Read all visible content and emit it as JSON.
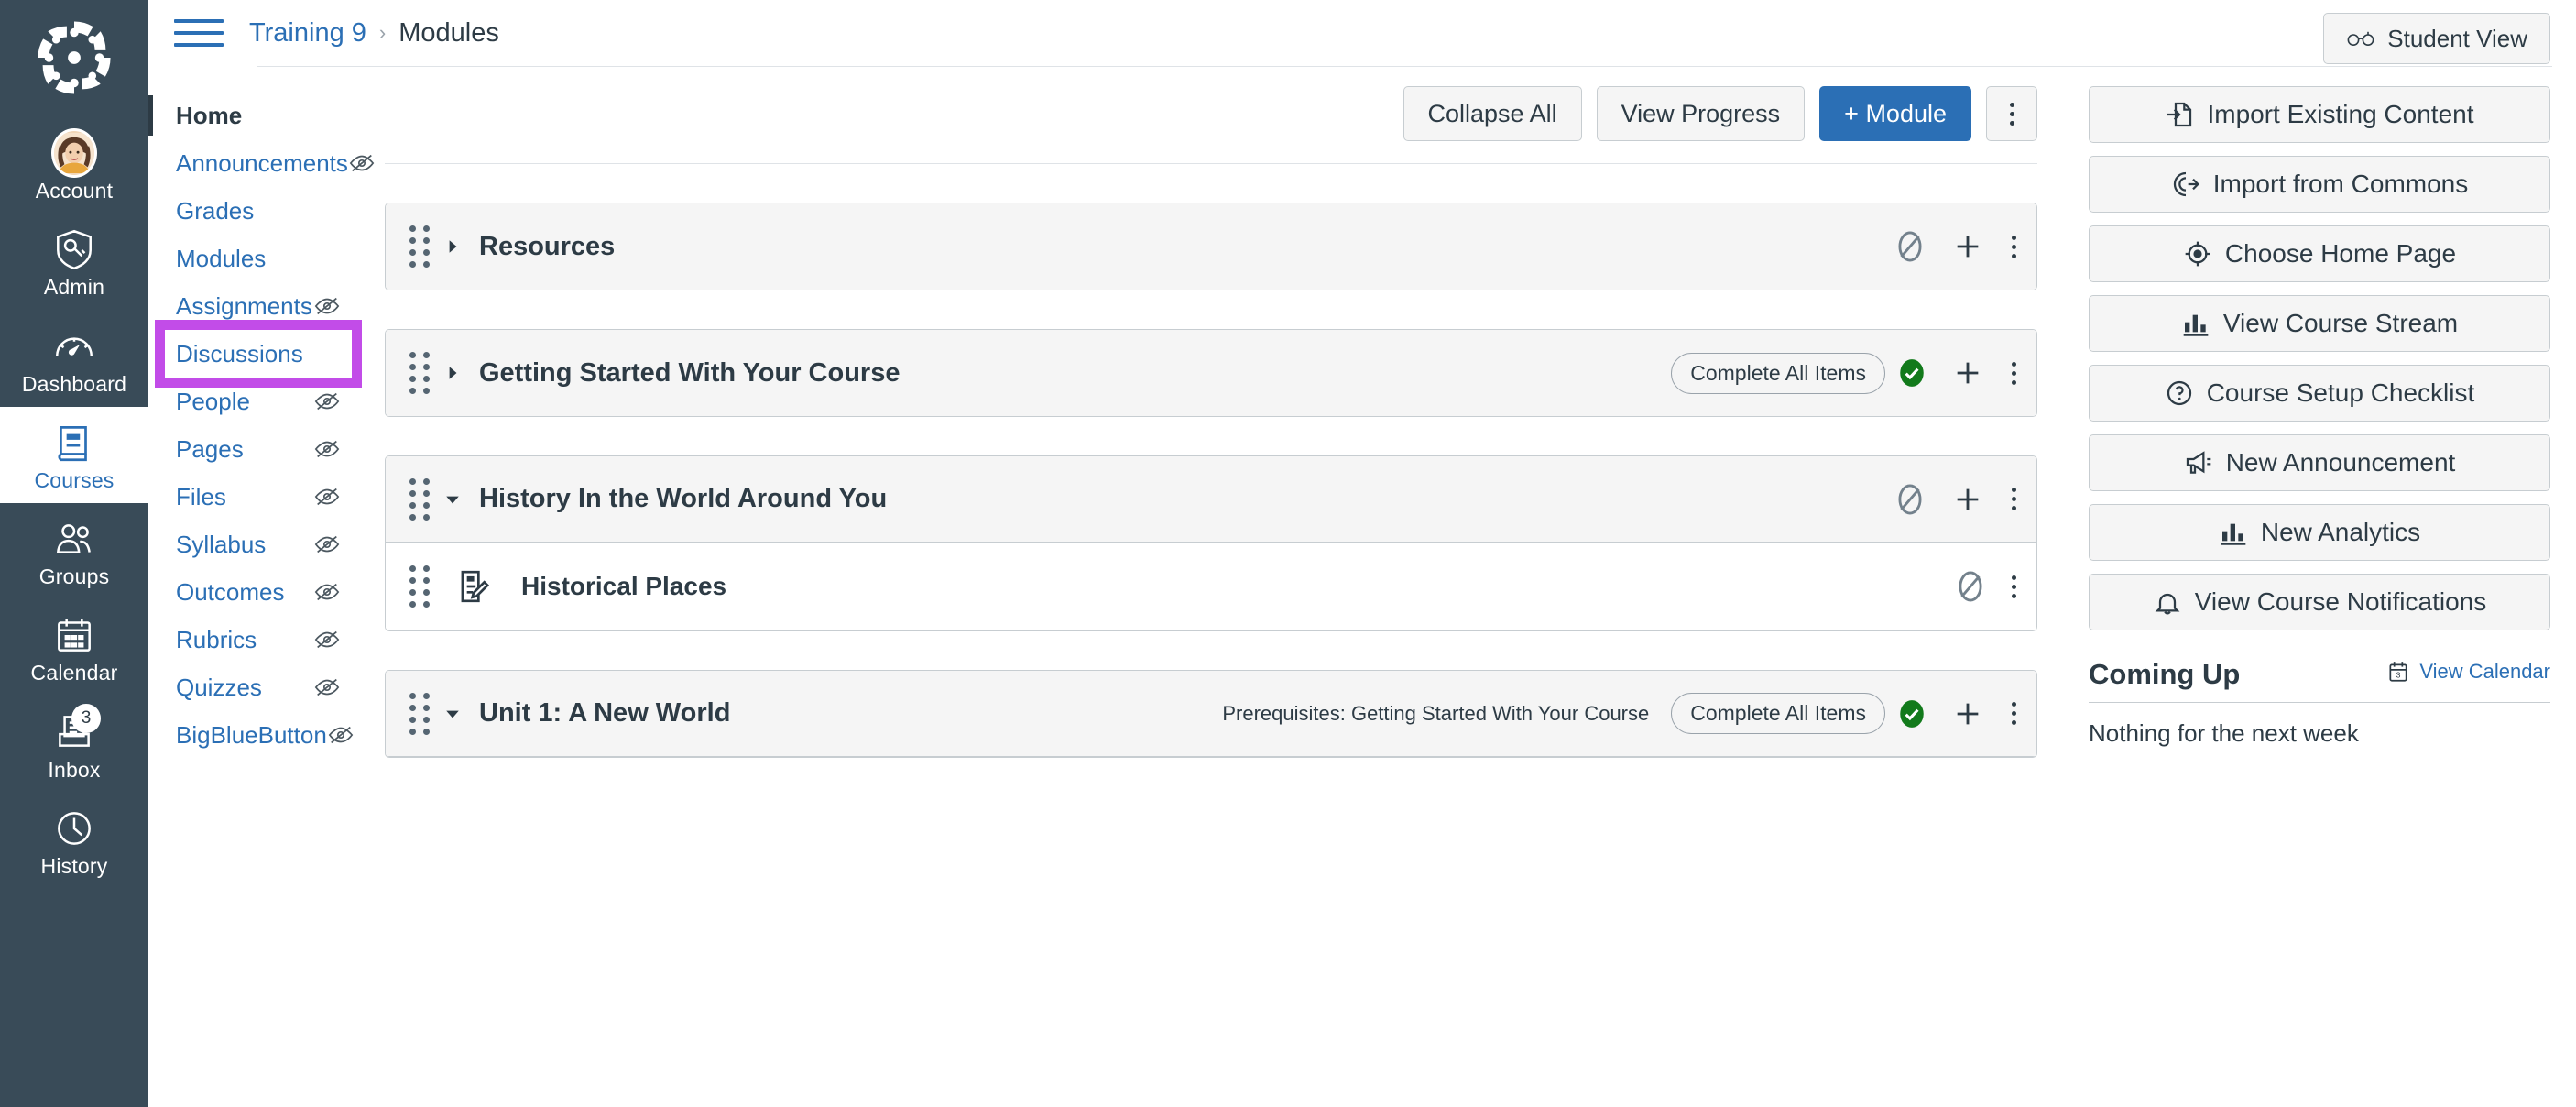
{
  "global_nav": {
    "logo_name": "canvas-logo",
    "items": [
      {
        "label": "Account",
        "icon": "avatar-icon",
        "active": false,
        "badge": null
      },
      {
        "label": "Admin",
        "icon": "shield-key-icon",
        "active": false,
        "badge": null
      },
      {
        "label": "Dashboard",
        "icon": "dashboard-gauge-icon",
        "active": false,
        "badge": null
      },
      {
        "label": "Courses",
        "icon": "courses-book-icon",
        "active": true,
        "badge": null
      },
      {
        "label": "Groups",
        "icon": "groups-people-icon",
        "active": false,
        "badge": null
      },
      {
        "label": "Calendar",
        "icon": "calendar-icon",
        "active": false,
        "badge": null
      },
      {
        "label": "Inbox",
        "icon": "inbox-icon",
        "active": false,
        "badge": "3"
      },
      {
        "label": "History",
        "icon": "clock-icon",
        "active": false,
        "badge": null
      }
    ]
  },
  "topbar": {
    "menu_icon": "hamburger-icon",
    "breadcrumb": {
      "course": "Training 9",
      "separator": "›",
      "current": "Modules"
    },
    "student_view": {
      "label": "Student View",
      "icon": "glasses-icon"
    }
  },
  "course_nav": {
    "items": [
      {
        "label": "Home",
        "active": true,
        "hidden_icon": false
      },
      {
        "label": "Announcements",
        "active": false,
        "hidden_icon": true
      },
      {
        "label": "Grades",
        "active": false,
        "hidden_icon": false
      },
      {
        "label": "Modules",
        "active": false,
        "hidden_icon": false
      },
      {
        "label": "Assignments",
        "active": false,
        "hidden_icon": true
      },
      {
        "label": "Discussions",
        "active": false,
        "hidden_icon": true,
        "highlighted": true
      },
      {
        "label": "People",
        "active": false,
        "hidden_icon": true
      },
      {
        "label": "Pages",
        "active": false,
        "hidden_icon": true
      },
      {
        "label": "Files",
        "active": false,
        "hidden_icon": true
      },
      {
        "label": "Syllabus",
        "active": false,
        "hidden_icon": true
      },
      {
        "label": "Outcomes",
        "active": false,
        "hidden_icon": true
      },
      {
        "label": "Rubrics",
        "active": false,
        "hidden_icon": true
      },
      {
        "label": "Quizzes",
        "active": false,
        "hidden_icon": true
      },
      {
        "label": "BigBlueButton",
        "active": false,
        "hidden_icon": true
      }
    ]
  },
  "toolbar": {
    "collapse_all": "Collapse All",
    "view_progress": "View Progress",
    "add_module": "+ Module",
    "kebab_name": "modules-options-menu"
  },
  "modules": [
    {
      "title": "Resources",
      "expanded": false,
      "prerequisites": null,
      "requirement_pill": null,
      "published": false,
      "items": []
    },
    {
      "title": "Getting Started With Your Course",
      "expanded": false,
      "prerequisites": null,
      "requirement_pill": "Complete All Items",
      "published": true,
      "items": []
    },
    {
      "title": "History In the World Around You",
      "expanded": true,
      "prerequisites": null,
      "requirement_pill": null,
      "published": false,
      "items": [
        {
          "title": "Historical Places",
          "icon": "assignment-edit-icon",
          "published": false
        }
      ]
    },
    {
      "title": "Unit 1: A New World",
      "expanded": true,
      "prerequisites": "Prerequisites: Getting Started With Your Course",
      "requirement_pill": "Complete All Items",
      "published": true,
      "items": []
    }
  ],
  "right_sidebar": {
    "buttons": [
      {
        "label": "Import Existing Content",
        "icon": "import-file-icon"
      },
      {
        "label": "Import from Commons",
        "icon": "commons-icon"
      },
      {
        "label": "Choose Home Page",
        "icon": "target-icon"
      },
      {
        "label": "View Course Stream",
        "icon": "bar-chart-icon"
      },
      {
        "label": "Course Setup Checklist",
        "icon": "question-circle-icon"
      },
      {
        "label": "New Announcement",
        "icon": "megaphone-icon"
      },
      {
        "label": "New Analytics",
        "icon": "bar-chart-icon"
      },
      {
        "label": "View Course Notifications",
        "icon": "bell-icon"
      }
    ],
    "coming_up": {
      "title": "Coming Up",
      "view_calendar": "View Calendar",
      "calendar_icon_day": "3",
      "empty_text": "Nothing for the next week"
    }
  },
  "colors": {
    "nav_bg": "#394B58",
    "link_blue": "#2B6FB5",
    "text_dark": "#2D3B45",
    "highlight_purple": "#C24CE8",
    "published_green": "#127A1B",
    "button_bg": "#F5F5F5",
    "border": "#C7CDD1"
  }
}
